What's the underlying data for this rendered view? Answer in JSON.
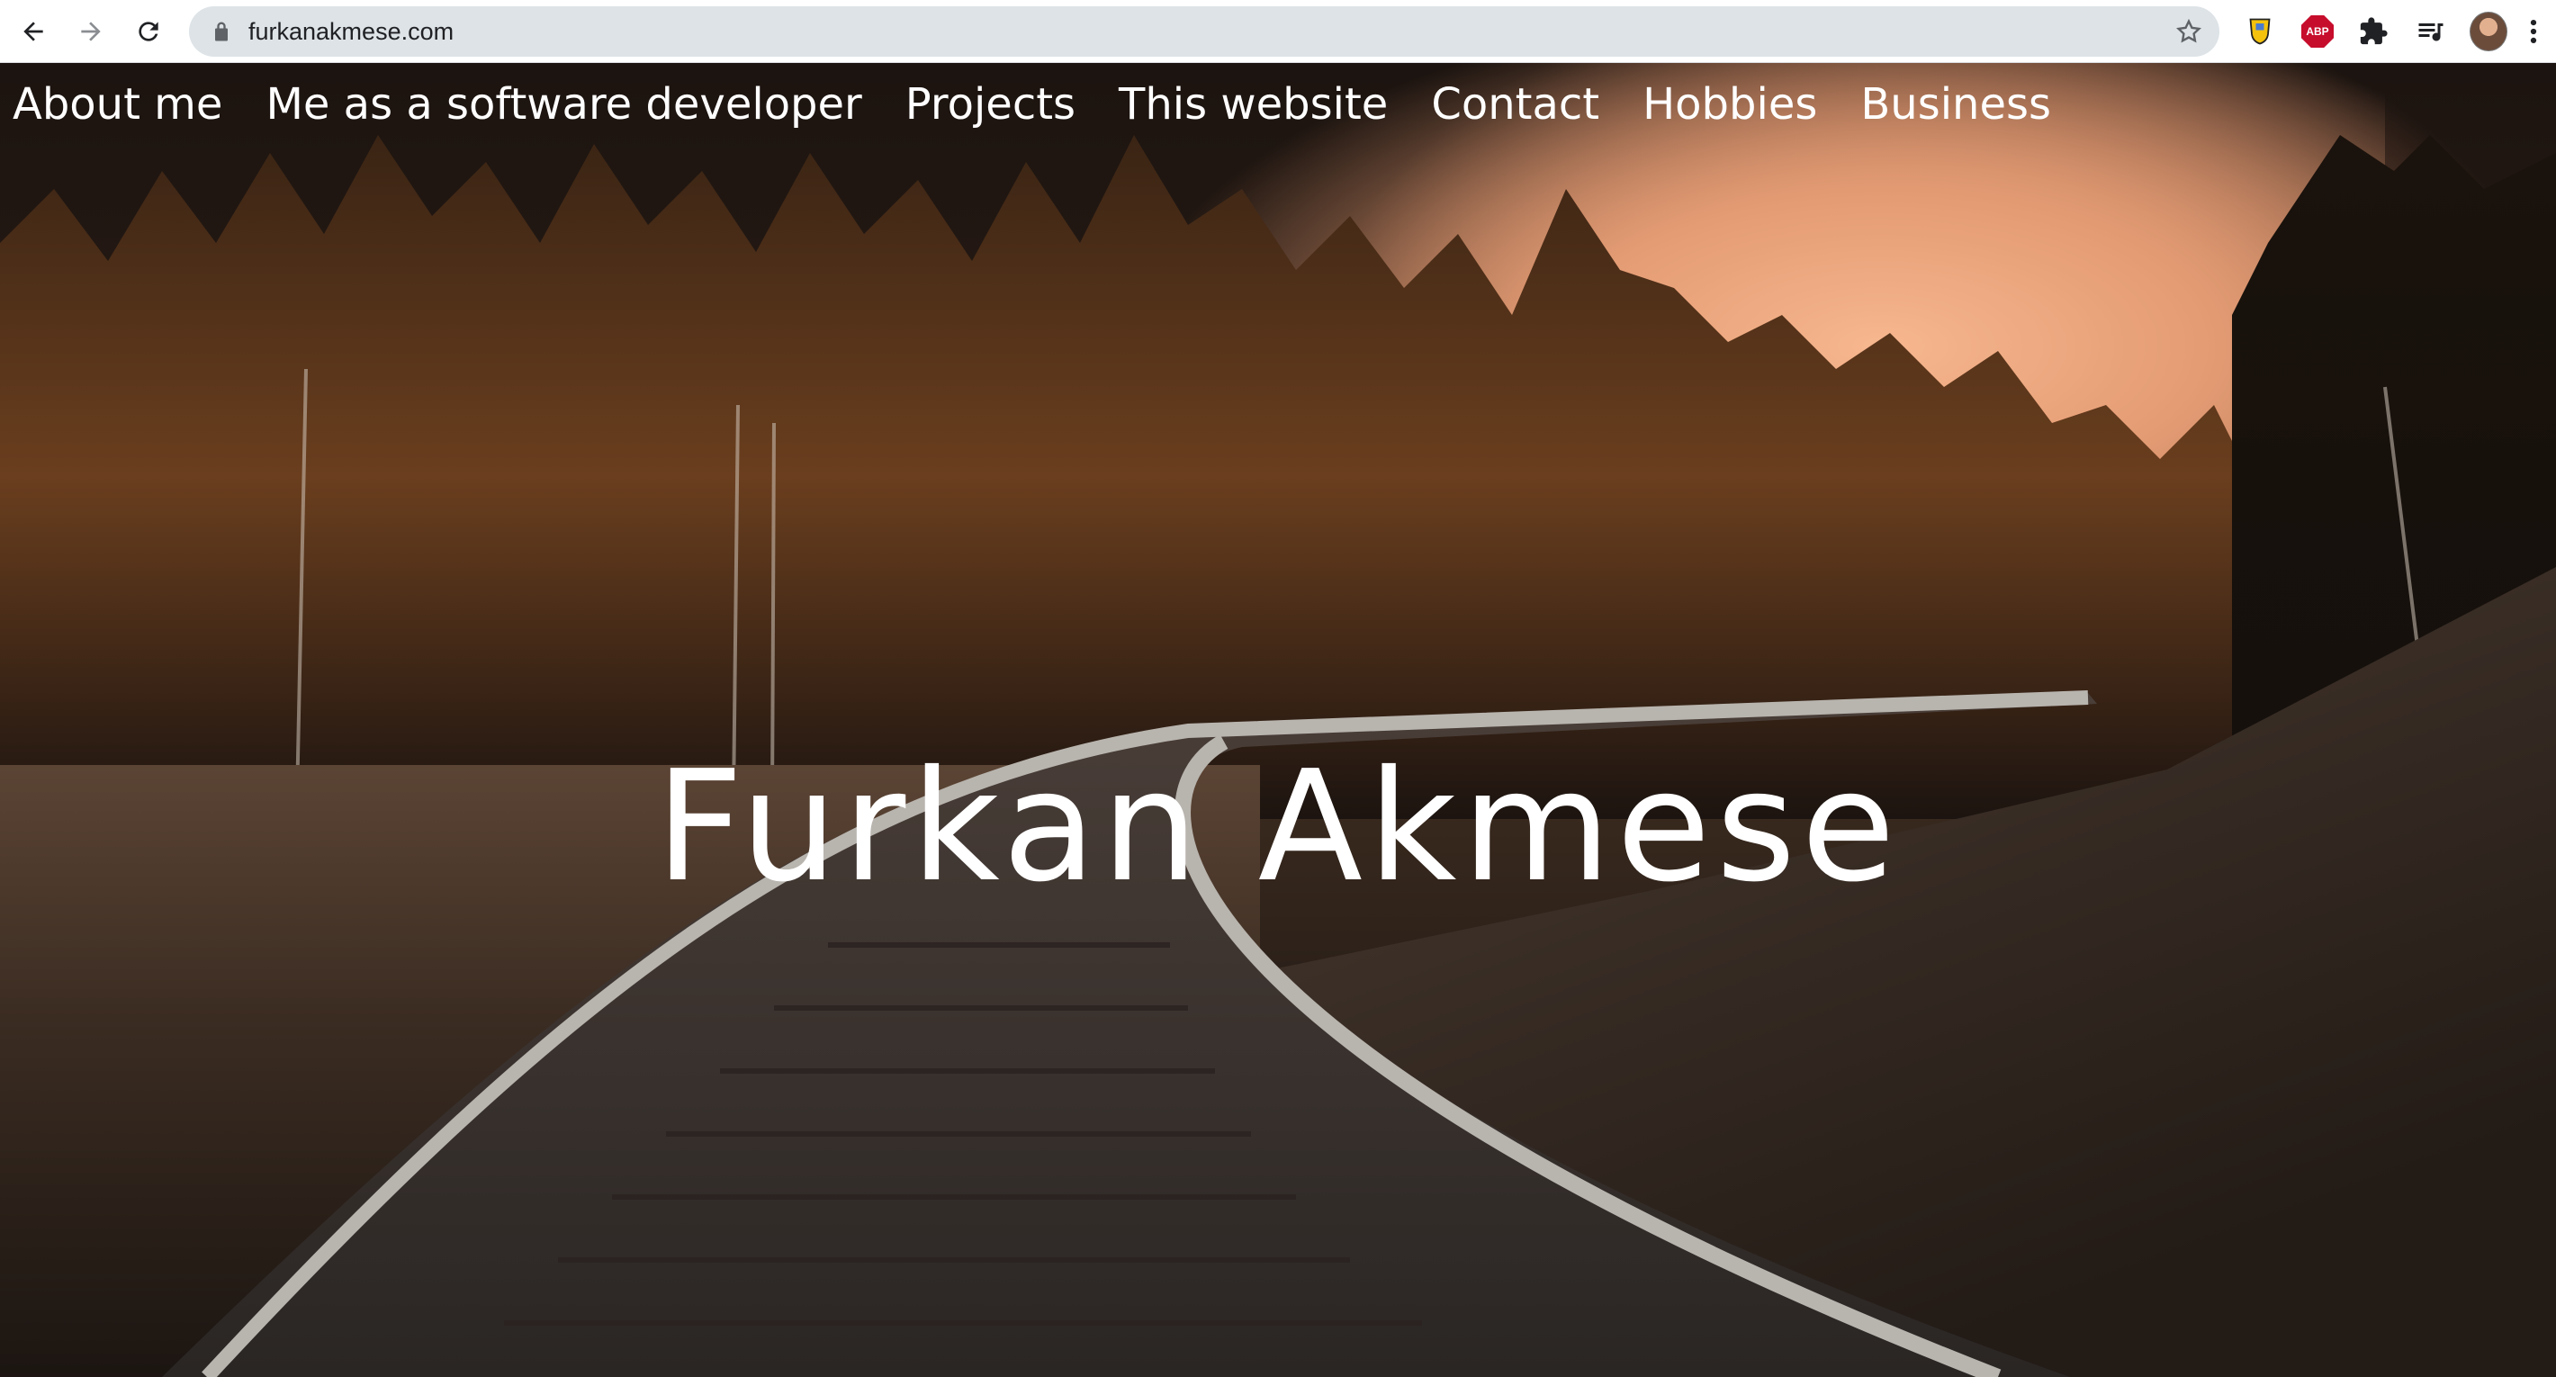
{
  "browser": {
    "url": "furkanakmese.com",
    "icons": [
      "back-arrow-icon",
      "forward-arrow-icon",
      "reload-icon",
      "lock-icon",
      "star-icon",
      "extension-shield-icon",
      "adblock-icon",
      "puzzle-icon",
      "media-queue-icon",
      "avatar",
      "kebab-menu-icon"
    ],
    "abp_label": "ABP"
  },
  "nav": {
    "items": [
      "About me",
      "Me as a software developer",
      "Projects",
      "This website",
      "Contact",
      "Hobbies",
      "Business"
    ]
  },
  "hero": {
    "title": "Furkan Akmese"
  },
  "colors": {
    "nav_text": "#ffffff",
    "omnibox_bg": "#dde3e7",
    "abp_red": "#c70d2c"
  }
}
